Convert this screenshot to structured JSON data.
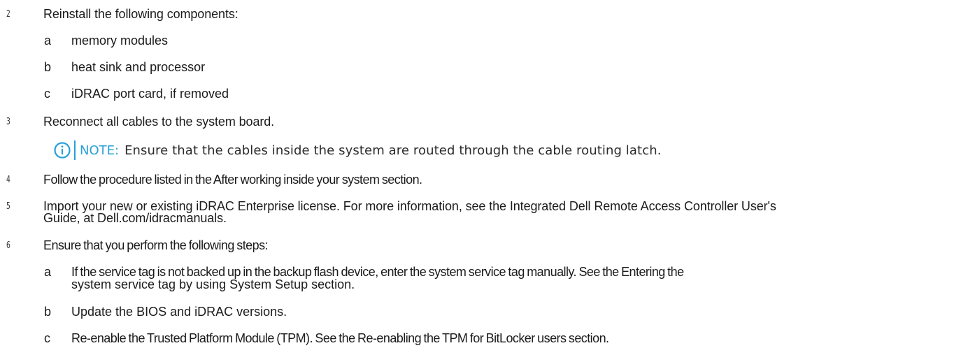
{
  "steps": [
    {
      "number": "2",
      "text": "Reinstall the following components:"
    },
    {
      "number": "3",
      "text": "Reconnect all cables to the system board."
    },
    {
      "number": "4",
      "text": "Follow the procedure listed in the After working inside your system section."
    },
    {
      "number": "5",
      "text_line1": "Import your new or existing iDRAC Enterprise license. For more information, see the Integrated Dell Remote Access Controller User's",
      "text_line2": "Guide, at Dell.com/idracmanuals."
    },
    {
      "number": "6",
      "text": "Ensure that you perform the following steps:"
    }
  ],
  "step2_subitems": [
    {
      "letter": "a",
      "text": "memory modules"
    },
    {
      "letter": "b",
      "text": "heat sink and processor"
    },
    {
      "letter": "c",
      "text": "iDRAC port card, if removed"
    }
  ],
  "note": {
    "label": "NOTE:",
    "text": "Ensure that the cables inside the system are routed through the cable routing latch.",
    "icon": "info-circle-icon",
    "accent_color": "#2a9fd8"
  },
  "step6_subitems": [
    {
      "letter": "a",
      "text_line1": "If the service tag is not backed up in the backup flash device, enter the system service tag manually. See the Entering the",
      "text_line2": "system service tag by using System Setup section."
    },
    {
      "letter": "b",
      "text": "Update the BIOS and iDRAC versions."
    },
    {
      "letter": "c",
      "text": "Re-enable the Trusted Platform Module (TPM). See the Re-enabling the TPM for BitLocker users section."
    }
  ]
}
